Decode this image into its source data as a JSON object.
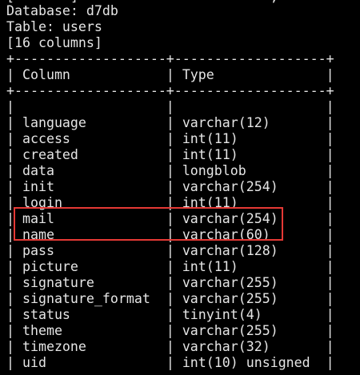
{
  "prompt_fragment": "[",
  "prompt_fragment_colored": "       ",
  "prompt_fragment_tail": "]                        , ~",
  "info": {
    "database_line": "Database: d7db",
    "table_line": "Table: users",
    "columns_line": "[16 columns]"
  },
  "table": {
    "border_top": "+-------------------+-------------------+",
    "header_sep": "+-------------------+-------------------+",
    "border_bottom": "+-------------------+-------------------+",
    "headers": [
      "Column",
      "Type"
    ],
    "rows": [
      {
        "column": "language",
        "type": "varchar(12)"
      },
      {
        "column": "access",
        "type": "int(11)"
      },
      {
        "column": "created",
        "type": "int(11)"
      },
      {
        "column": "data",
        "type": "longblob"
      },
      {
        "column": "init",
        "type": "varchar(254)"
      },
      {
        "column": "login",
        "type": "int(11)"
      },
      {
        "column": "mail",
        "type": "varchar(254)"
      },
      {
        "column": "name",
        "type": "varchar(60)"
      },
      {
        "column": "pass",
        "type": "varchar(128)"
      },
      {
        "column": "picture",
        "type": "int(11)"
      },
      {
        "column": "signature",
        "type": "varchar(255)"
      },
      {
        "column": "signature_format",
        "type": "varchar(255)"
      },
      {
        "column": "status",
        "type": "tinyint(4)"
      },
      {
        "column": "theme",
        "type": "varchar(255)"
      },
      {
        "column": "timezone",
        "type": "varchar(32)"
      },
      {
        "column": "uid",
        "type": "int(10) unsigned"
      }
    ]
  },
  "highlight": {
    "rows": [
      "name",
      "pass"
    ],
    "color": "#e53935"
  },
  "colors": {
    "background": "#000000",
    "text": "#e5e5e5",
    "prompt_accent": "#2fa8e0"
  }
}
